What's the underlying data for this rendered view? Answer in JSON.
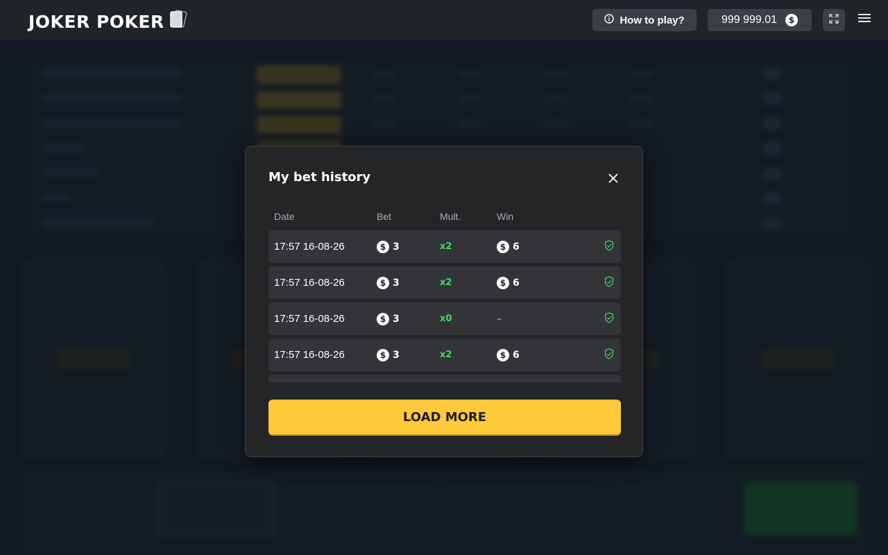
{
  "header": {
    "logo_text": "JOKER POKER",
    "how_to_play_label": "How to play?",
    "balance": "999 999.01",
    "currency_symbol": "$"
  },
  "modal": {
    "title": "My bet history",
    "columns": [
      "Date",
      "Bet",
      "Mult.",
      "Win"
    ],
    "rows": [
      {
        "date": "17:57 16-08-26",
        "bet": "3",
        "mult": "x2",
        "win": "6"
      },
      {
        "date": "17:57 16-08-26",
        "bet": "3",
        "mult": "x2",
        "win": "6"
      },
      {
        "date": "17:57 16-08-26",
        "bet": "3",
        "mult": "x0",
        "win": "–"
      },
      {
        "date": "17:57 16-08-26",
        "bet": "3",
        "mult": "x2",
        "win": "6"
      }
    ],
    "load_more_label": "LOAD MORE"
  },
  "colors": {
    "accent_yellow": "#ffca3a",
    "multiplier_green": "#3ddc5f",
    "header_bg": "#202428",
    "modal_bg": "#232527"
  },
  "icons": {
    "info": "info-icon",
    "coin": "dollar-coin-icon",
    "fullscreen": "expand-icon",
    "menu": "hamburger-menu-icon",
    "close": "close-icon",
    "verify": "shield-check-icon"
  }
}
